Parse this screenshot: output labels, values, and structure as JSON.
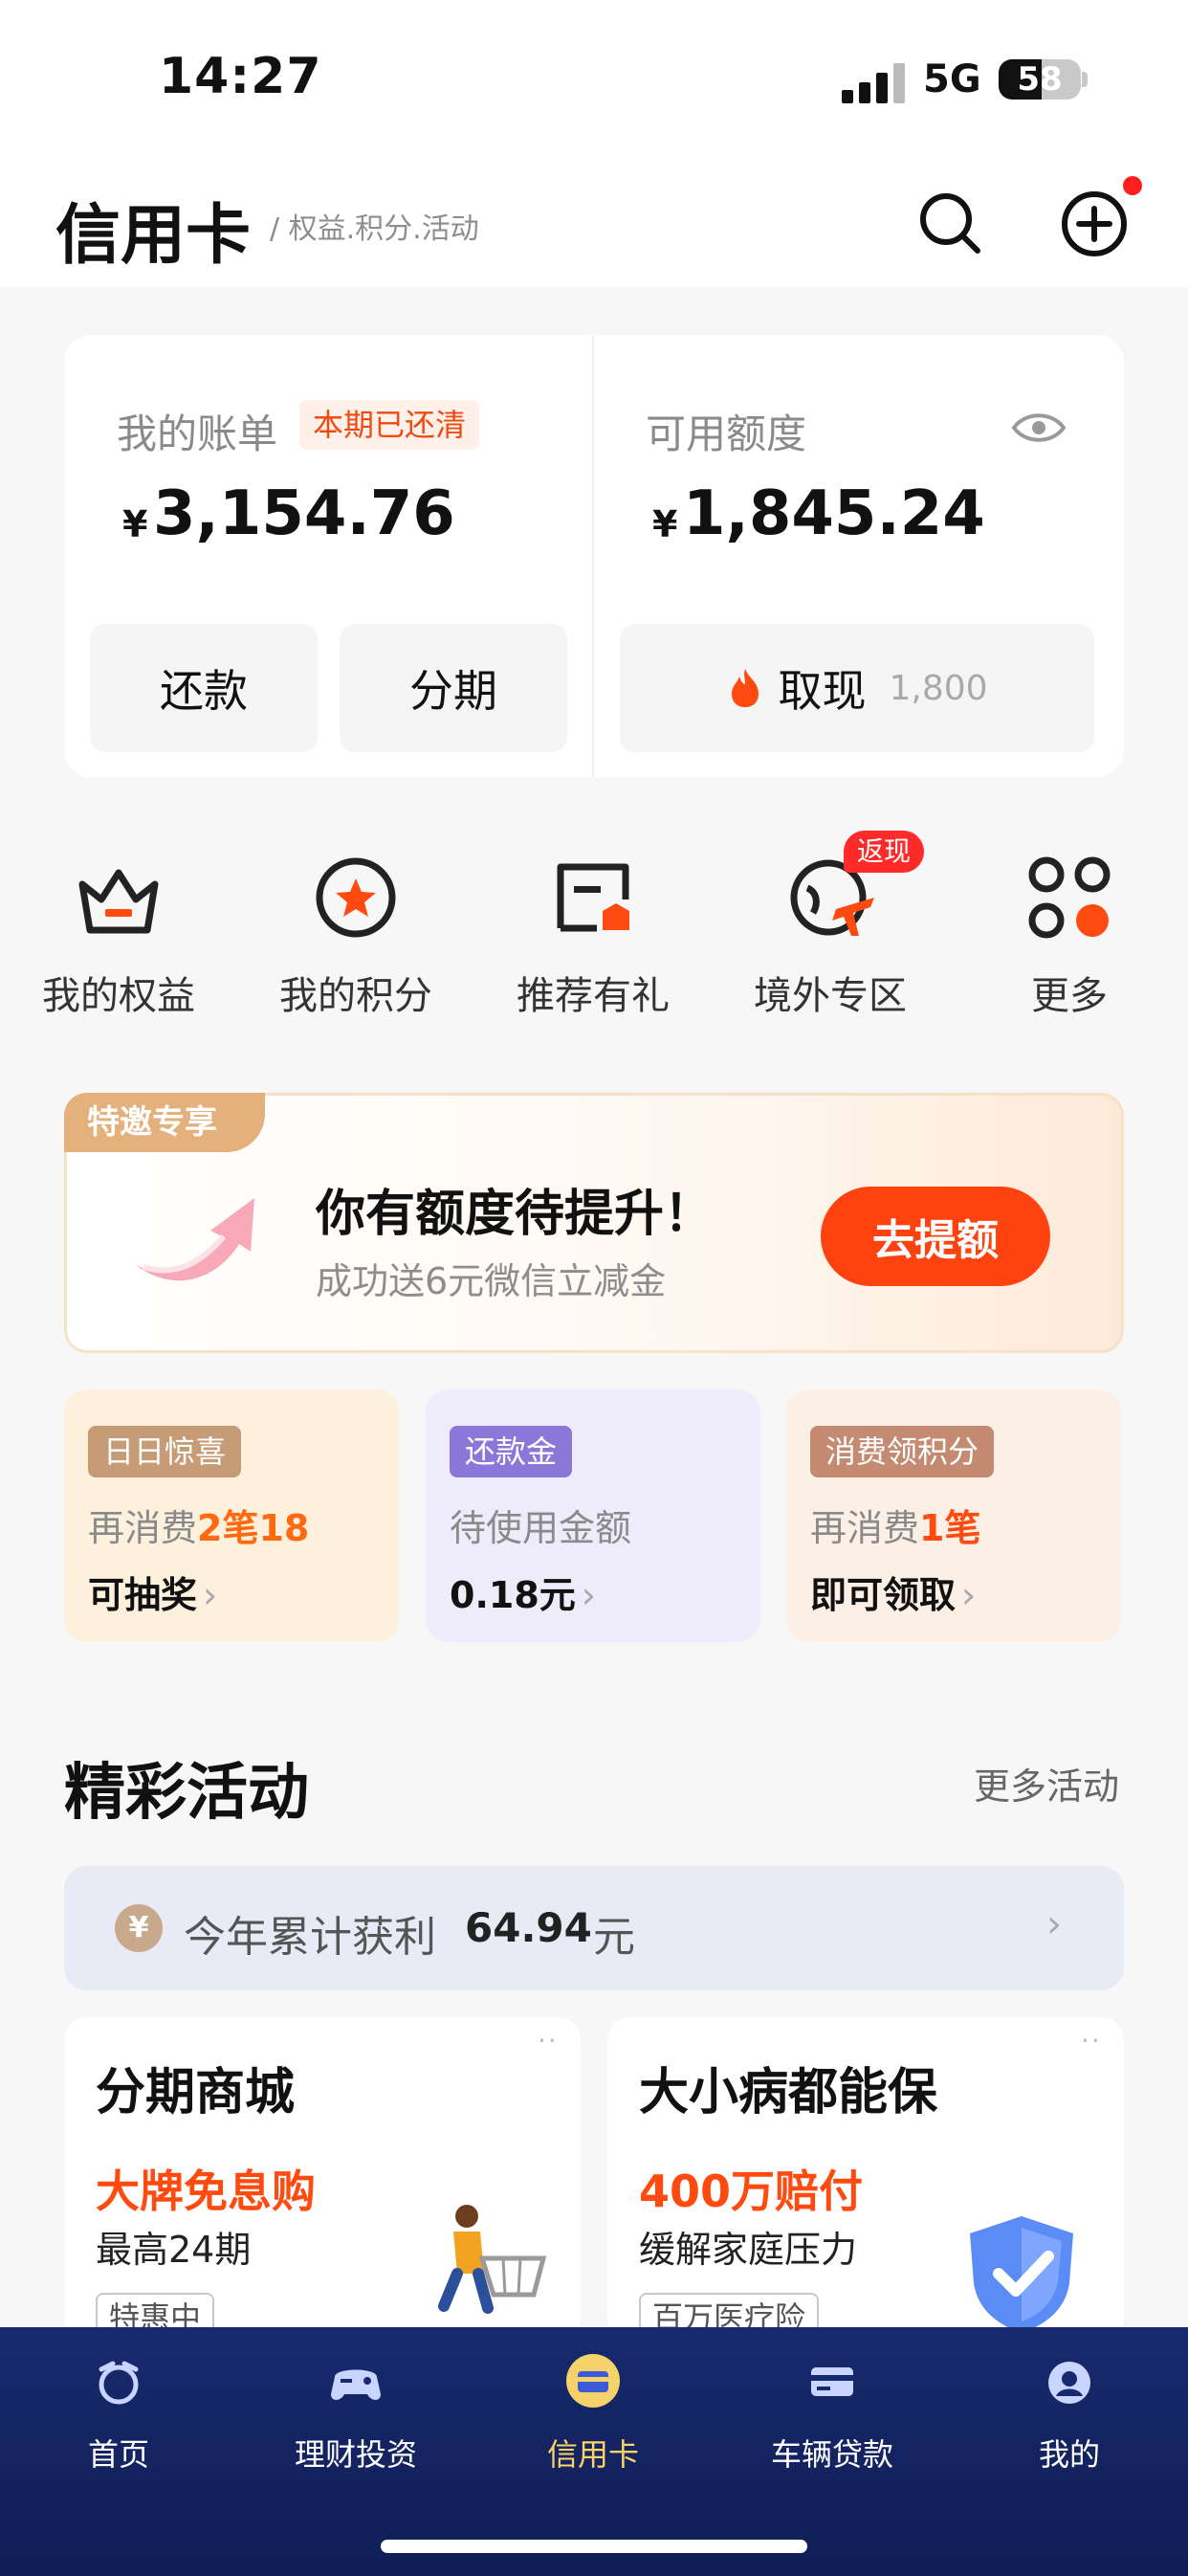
{
  "status_bar": {
    "time": "14:27",
    "network": "5G",
    "battery_level": "58"
  },
  "header": {
    "title": "信用卡",
    "subtitle": "/ 权益.积分.活动",
    "search_icon": "search-icon",
    "add_icon": "add-circle-icon"
  },
  "account": {
    "bill_label": "我的账单",
    "bill_status": "本期已还清",
    "bill_currency": "¥",
    "bill_amount": "3,154.76",
    "available_label": "可用额度",
    "available_currency": "¥",
    "available_amount": "1,845.24",
    "repay_label": "还款",
    "installment_label": "分期",
    "cash_label": "取现",
    "cash_limit": "1,800"
  },
  "shortcuts": [
    {
      "label": "我的权益",
      "icon": "crown-basket-icon"
    },
    {
      "label": "我的积分",
      "icon": "star-circle-icon"
    },
    {
      "label": "推荐有礼",
      "icon": "referral-card-icon"
    },
    {
      "label": "境外专区",
      "icon": "globe-plane-icon",
      "badge": "返现"
    },
    {
      "label": "更多",
      "icon": "more-grid-icon"
    }
  ],
  "promo": {
    "tag": "特邀专享",
    "title": "你有额度待提升！",
    "subtitle": "成功送6元微信立减金",
    "button": "去提额"
  },
  "mini_cards": [
    {
      "tag": "日日惊喜",
      "line1_prefix": "再消费",
      "line1_highlight": "2笔18",
      "line2": "可抽奖"
    },
    {
      "tag": "还款金",
      "line1_prefix": "待使用金额",
      "line1_highlight": "",
      "line2": "0.18元"
    },
    {
      "tag": "消费领积分",
      "line1_prefix": "再消费",
      "line1_highlight": "1笔",
      "line2": "即可领取"
    }
  ],
  "activities": {
    "title": "精彩活动",
    "more": "更多活动",
    "earnings_label": "今年累计获利",
    "earnings_value": "64.94",
    "earnings_unit": "元",
    "coin_symbol": "¥",
    "cards": [
      {
        "title": "分期商城",
        "highlight": "大牌免息购",
        "subtitle": "最高24期",
        "chip": "特惠中"
      },
      {
        "title": "大小病都能保",
        "highlight": "400万赔付",
        "subtitle": "缓解家庭压力",
        "chip": "百万医疗险"
      }
    ]
  },
  "tabbar": [
    {
      "label": "首页",
      "icon": "home-icon",
      "active": false
    },
    {
      "label": "理财投资",
      "icon": "gamepad-icon",
      "active": false
    },
    {
      "label": "信用卡",
      "icon": "credit-card-wallet-icon",
      "active": true
    },
    {
      "label": "车辆贷款",
      "icon": "car-loan-icon",
      "active": false
    },
    {
      "label": "我的",
      "icon": "profile-icon",
      "active": false
    }
  ],
  "colors": {
    "accent": "#ff4310",
    "badge_red": "#ff2a2a",
    "tabbar_bg": "#142563"
  }
}
